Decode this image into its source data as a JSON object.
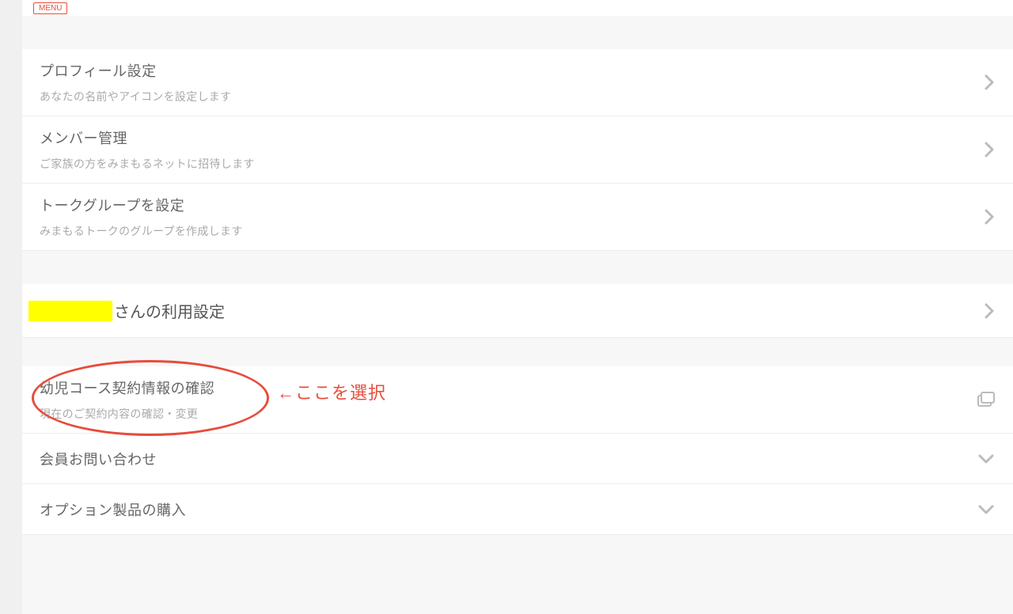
{
  "badge": "MENU",
  "items": {
    "profile": {
      "title": "プロフィール設定",
      "subtitle": "あなたの名前やアイコンを設定します"
    },
    "members": {
      "title": "メンバー管理",
      "subtitle": "ご家族の方をみまもるネットに招待します"
    },
    "talkgroup": {
      "title": "トークグループを設定",
      "subtitle": "みまもるトークのグループを作成します"
    },
    "usage": {
      "suffix": "さんの利用設定"
    },
    "contract": {
      "title": "幼児コース契約情報の確認",
      "subtitle": "現在のご契約内容の確認・変更"
    },
    "inquiry": {
      "title": "会員お問い合わせ"
    },
    "option": {
      "title": "オプション製品の購入"
    }
  },
  "annotation": {
    "text": "←ここを選択"
  }
}
